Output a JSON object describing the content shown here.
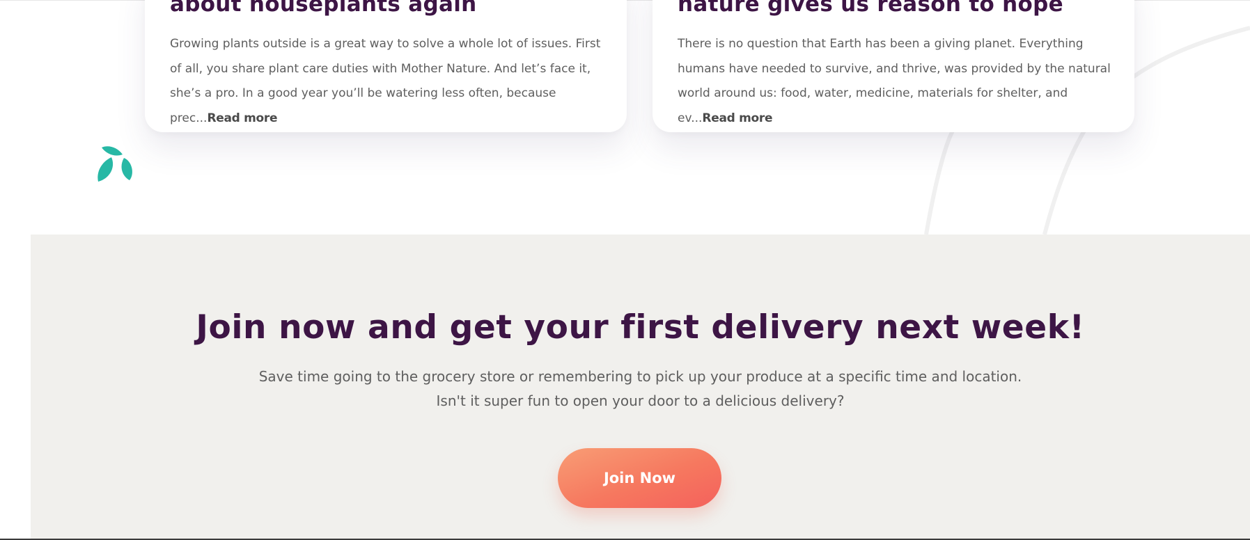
{
  "cards": [
    {
      "title": "about houseplants again",
      "excerpt": "Growing plants outside is a great way to solve a whole lot of issues. First of all, you share plant care duties with Mother Nature. And let’s face it, she’s a pro. In a good year you’ll be watering less often, because prec...",
      "read_more": "Read more"
    },
    {
      "title": "nature gives us reason to hope",
      "excerpt": "There is no question that Earth has been a giving planet. Everything humans have needed to survive, and thrive, was provided by the natural world around us: food, water, medicine, materials for shelter, and ev...",
      "read_more": "Read more"
    }
  ],
  "decor": {
    "leaf_icon": "leaf-icon",
    "leaf_color": "#27b8a5"
  },
  "cta": {
    "title": "Join now and get your first delivery next week!",
    "subtitle_line1": "Save time going to the grocery store or remembering to pick up your produce at a specific time and location.",
    "subtitle_line2": "Isn't it super fun to open your door to a delicious delivery?",
    "button_label": "Join Now",
    "button_color": "#f6785f",
    "title_color": "#3d1545",
    "background": "#f1f0ed"
  }
}
